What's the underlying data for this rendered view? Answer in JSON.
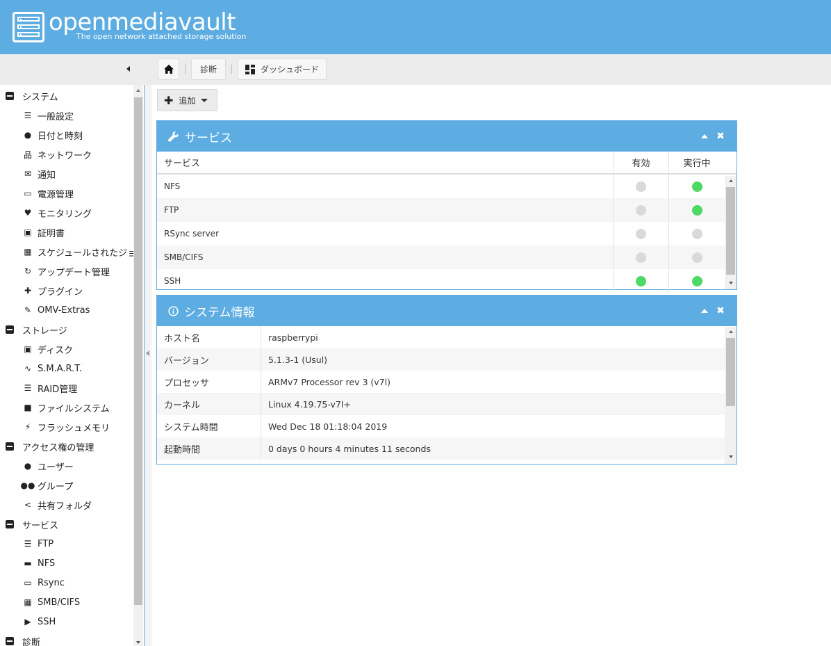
{
  "header": {
    "title": "openmediavault",
    "subtitle": "The open network attached storage solution"
  },
  "breadcrumb": {
    "items": [
      "診断",
      "ダッシュボード"
    ]
  },
  "sidebar": {
    "items": [
      {
        "type": "cat",
        "label": "システム",
        "icon": "minus-square-icon"
      },
      {
        "type": "sub",
        "label": "一般設定",
        "icon": "sliders-icon"
      },
      {
        "type": "sub",
        "label": "日付と時刻",
        "icon": "clock-icon"
      },
      {
        "type": "sub",
        "label": "ネットワーク",
        "icon": "sitemap-icon"
      },
      {
        "type": "sub",
        "label": "通知",
        "icon": "envelope-icon"
      },
      {
        "type": "sub",
        "label": "電源管理",
        "icon": "battery-icon"
      },
      {
        "type": "sub",
        "label": "モニタリング",
        "icon": "heartbeat-icon"
      },
      {
        "type": "sub",
        "label": "証明書",
        "icon": "certificate-icon"
      },
      {
        "type": "sub",
        "label": "スケジュールされたジョブ",
        "icon": "calendar-clock-icon"
      },
      {
        "type": "sub",
        "label": "アップデート管理",
        "icon": "refresh-icon"
      },
      {
        "type": "sub",
        "label": "プラグイン",
        "icon": "puzzle-icon"
      },
      {
        "type": "sub",
        "label": "OMV-Extras",
        "icon": "plug-icon"
      },
      {
        "type": "cat",
        "label": "ストレージ",
        "icon": "minus-square-icon"
      },
      {
        "type": "sub",
        "label": "ディスク",
        "icon": "disk-icon"
      },
      {
        "type": "sub",
        "label": "S.M.A.R.T.",
        "icon": "pulse-icon"
      },
      {
        "type": "sub",
        "label": "RAID管理",
        "icon": "database-icon"
      },
      {
        "type": "sub",
        "label": "ファイルシステム",
        "icon": "folder-icon"
      },
      {
        "type": "sub",
        "label": "フラッシュメモリ",
        "icon": "bolt-icon"
      },
      {
        "type": "cat",
        "label": "アクセス権の管理",
        "icon": "minus-square-icon"
      },
      {
        "type": "sub",
        "label": "ユーザー",
        "icon": "user-icon"
      },
      {
        "type": "sub",
        "label": "グループ",
        "icon": "users-icon"
      },
      {
        "type": "sub",
        "label": "共有フォルダ",
        "icon": "share-icon"
      },
      {
        "type": "cat",
        "label": "サービス",
        "icon": "minus-square-icon"
      },
      {
        "type": "sub",
        "label": "FTP",
        "icon": "server-icon"
      },
      {
        "type": "sub",
        "label": "NFS",
        "icon": "desktop-icon"
      },
      {
        "type": "sub",
        "label": "Rsync",
        "icon": "network-icon"
      },
      {
        "type": "sub",
        "label": "SMB/CIFS",
        "icon": "windows-icon"
      },
      {
        "type": "sub",
        "label": "SSH",
        "icon": "terminal-icon"
      },
      {
        "type": "cat",
        "label": "診断",
        "icon": "minus-square-icon"
      }
    ]
  },
  "toolbar": {
    "add_label": "追加"
  },
  "services_widget": {
    "title": "サービス",
    "columns": [
      "サービス",
      "有効",
      "実行中"
    ],
    "rows": [
      {
        "name": "NFS",
        "enabled": false,
        "running": true
      },
      {
        "name": "FTP",
        "enabled": false,
        "running": true
      },
      {
        "name": "RSync server",
        "enabled": false,
        "running": false
      },
      {
        "name": "SMB/CIFS",
        "enabled": false,
        "running": false
      },
      {
        "name": "SSH",
        "enabled": true,
        "running": true
      }
    ]
  },
  "sysinfo_widget": {
    "title": "システム情報",
    "rows": [
      {
        "key": "ホスト名",
        "value": "raspberrypi"
      },
      {
        "key": "バージョン",
        "value": "5.1.3-1 (Usul)"
      },
      {
        "key": "プロセッサ",
        "value": "ARMv7 Processor rev 3 (v7l)"
      },
      {
        "key": "カーネル",
        "value": "Linux 4.19.75-v7l+"
      },
      {
        "key": "システム時間",
        "value": "Wed Dec 18 01:18:04 2019"
      },
      {
        "key": "起動時間",
        "value": "0 days 0 hours 4 minutes 11 seconds"
      }
    ]
  },
  "colors": {
    "accent": "#5dade2",
    "status_on": "#4cd964",
    "status_off": "#d9d9d9"
  }
}
